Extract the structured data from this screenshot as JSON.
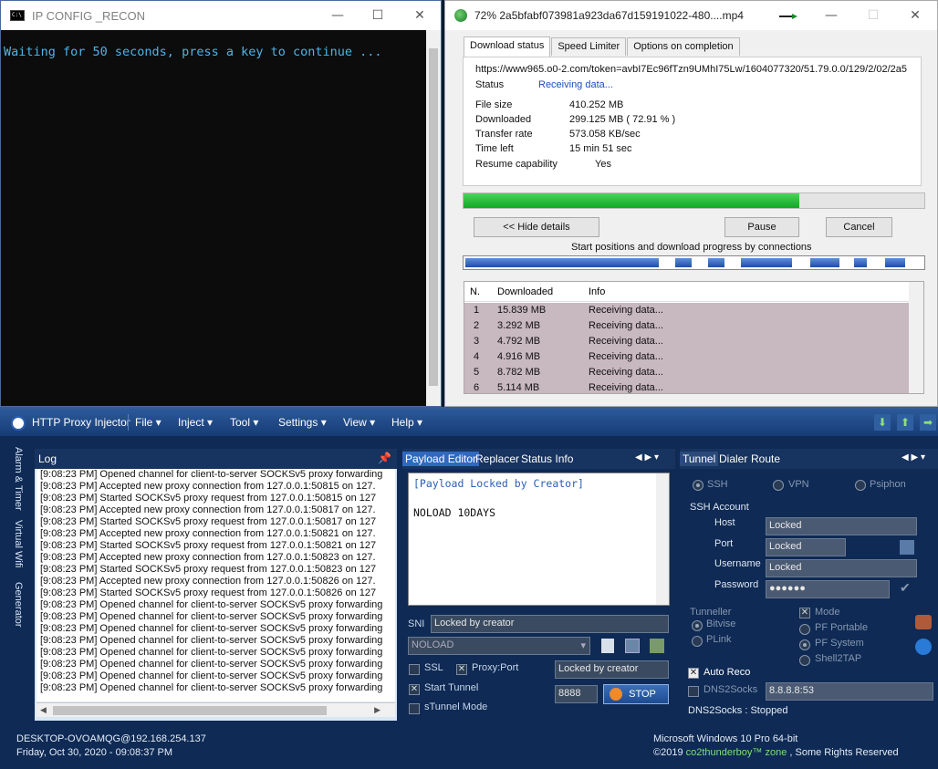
{
  "console": {
    "title": "IP CONFIG _RECON",
    "text": "Waiting for 50 seconds, press a key to continue ..."
  },
  "download": {
    "title": "72% 2a5bfabf073981a923da67d159191022-480....mp4",
    "tabs": [
      "Download status",
      "Speed Limiter",
      "Options on completion"
    ],
    "url": "https://www965.o0-2.com/token=avbI7Ec96fTzn9UMhI75Lw/1604077320/51.79.0.0/129/2/02/2a5",
    "status_label": "Status",
    "status_value": "Receiving data...",
    "file_size_label": "File size",
    "file_size_value": "410.252  MB",
    "downloaded_label": "Downloaded",
    "downloaded_value": "299.125  MB  ( 72.91 % )",
    "transfer_rate_label": "Transfer rate",
    "transfer_rate_value": "573.058  KB/sec",
    "time_left_label": "Time left",
    "time_left_value": "15 min 51 sec",
    "resume_label": "Resume capability",
    "resume_value": "Yes",
    "progress": 0.7291,
    "hide_details": "<< Hide details",
    "pause": "Pause",
    "cancel": "Cancel",
    "connections_caption": "Start positions and download progress by connections",
    "table_headers": [
      "N.",
      "Downloaded",
      "Info"
    ],
    "rows": [
      {
        "n": "1",
        "downloaded": "15.839  MB",
        "info": "Receiving data..."
      },
      {
        "n": "2",
        "downloaded": "3.292  MB",
        "info": "Receiving data..."
      },
      {
        "n": "3",
        "downloaded": "4.792  MB",
        "info": "Receiving data..."
      },
      {
        "n": "4",
        "downloaded": "4.916  MB",
        "info": "Receiving data..."
      },
      {
        "n": "5",
        "downloaded": "8.782  MB",
        "info": "Receiving data..."
      },
      {
        "n": "6",
        "downloaded": "5.114  MB",
        "info": "Receiving data..."
      }
    ]
  },
  "hpi": {
    "title": "HTTP Proxy Injector",
    "menu": [
      "File",
      "Inject",
      "Tool",
      "Settings",
      "View",
      "Help"
    ],
    "side_tabs": [
      "Alarm & Timer",
      "Virtual Wifi",
      "Generator"
    ],
    "log_title": "Log",
    "log_lines": [
      "[9:08:23 PM] Opened channel for client-to-server SOCKSv5 proxy forwarding",
      "[9:08:23 PM] Accepted new proxy connection from 127.0.0.1:50815 on 127.",
      "[9:08:23 PM] Started SOCKSv5 proxy request from 127.0.0.1:50815 on 127",
      "[9:08:23 PM] Accepted new proxy connection from 127.0.0.1:50817 on 127.",
      "[9:08:23 PM] Started SOCKSv5 proxy request from 127.0.0.1:50817 on 127",
      "[9:08:23 PM] Accepted new proxy connection from 127.0.0.1:50821 on 127.",
      "[9:08:23 PM] Started SOCKSv5 proxy request from 127.0.0.1:50821 on 127",
      "[9:08:23 PM] Accepted new proxy connection from 127.0.0.1:50823 on 127.",
      "[9:08:23 PM] Started SOCKSv5 proxy request from 127.0.0.1:50823 on 127",
      "[9:08:23 PM] Accepted new proxy connection from 127.0.0.1:50826 on 127.",
      "[9:08:23 PM] Started SOCKSv5 proxy request from 127.0.0.1:50826 on 127",
      "[9:08:23 PM] Opened channel for client-to-server SOCKSv5 proxy forwarding",
      "[9:08:23 PM] Opened channel for client-to-server SOCKSv5 proxy forwarding",
      "[9:08:23 PM] Opened channel for client-to-server SOCKSv5 proxy forwarding",
      "[9:08:23 PM] Opened channel for client-to-server SOCKSv5 proxy forwarding",
      "[9:08:23 PM] Opened channel for client-to-server SOCKSv5 proxy forwarding",
      "[9:08:23 PM] Opened channel for client-to-server SOCKSv5 proxy forwarding",
      "[9:08:23 PM] Opened channel for client-to-server SOCKSv5 proxy forwarding",
      "[9:08:23 PM] Opened channel for client-to-server SOCKSv5 proxy forwarding"
    ],
    "mid_tabs": [
      "Payload Editor",
      "Replacer",
      "Status Info"
    ],
    "payload_line1": "[Payload Locked by Creator]",
    "payload_line2": "NOLOAD 10DAYS",
    "sni_label": "SNI",
    "sni_value": "Locked by creator",
    "noload_select": "NOLOAD",
    "ssl_label": "SSL",
    "proxy_port_label": "Proxy:Port",
    "proxy_value": "Locked by creator",
    "start_tunnel_label": "Start Tunnel",
    "port_value": "8888",
    "stop_label": "STOP",
    "stunnel_label": "sTunnel Mode",
    "right_tabs": [
      "Tunnel",
      "Dialer",
      "Route"
    ],
    "modes": [
      "SSH",
      "VPN",
      "Psiphon"
    ],
    "ssh_account": "SSH Account",
    "host_label": "Host",
    "host_value": "Locked",
    "port_label": "Port",
    "port_field": "Locked",
    "username_label": "Username",
    "username_value": "Locked",
    "password_label": "Password",
    "password_value": "●●●●●●",
    "tunneller_label": "Tunneller",
    "bitvise_label": "Bitvise",
    "plink_label": "PLink",
    "mode_label": "Mode",
    "pf_portable_label": "PF Portable",
    "pf_system_label": "PF System",
    "shell2tap_label": "Shell2TAP",
    "auto_reco_label": "Auto Reco",
    "dns2socks_label": "DNS2Socks",
    "dns_value": "8.8.8.8:53",
    "dns_status": "DNS2Socks : Stopped",
    "status_left_1": "DESKTOP-OVOAMQG@192.168.254.137",
    "status_left_2": "Friday, Oct 30, 2020 - 09:08:37 PM",
    "status_right_1": "Microsoft Windows 10 Pro 64-bit",
    "status_right_2_a": "©2019 ",
    "status_right_2_b": "co2thunderboy™ zone",
    "status_right_2_c": " , Some Rights Reserved"
  }
}
